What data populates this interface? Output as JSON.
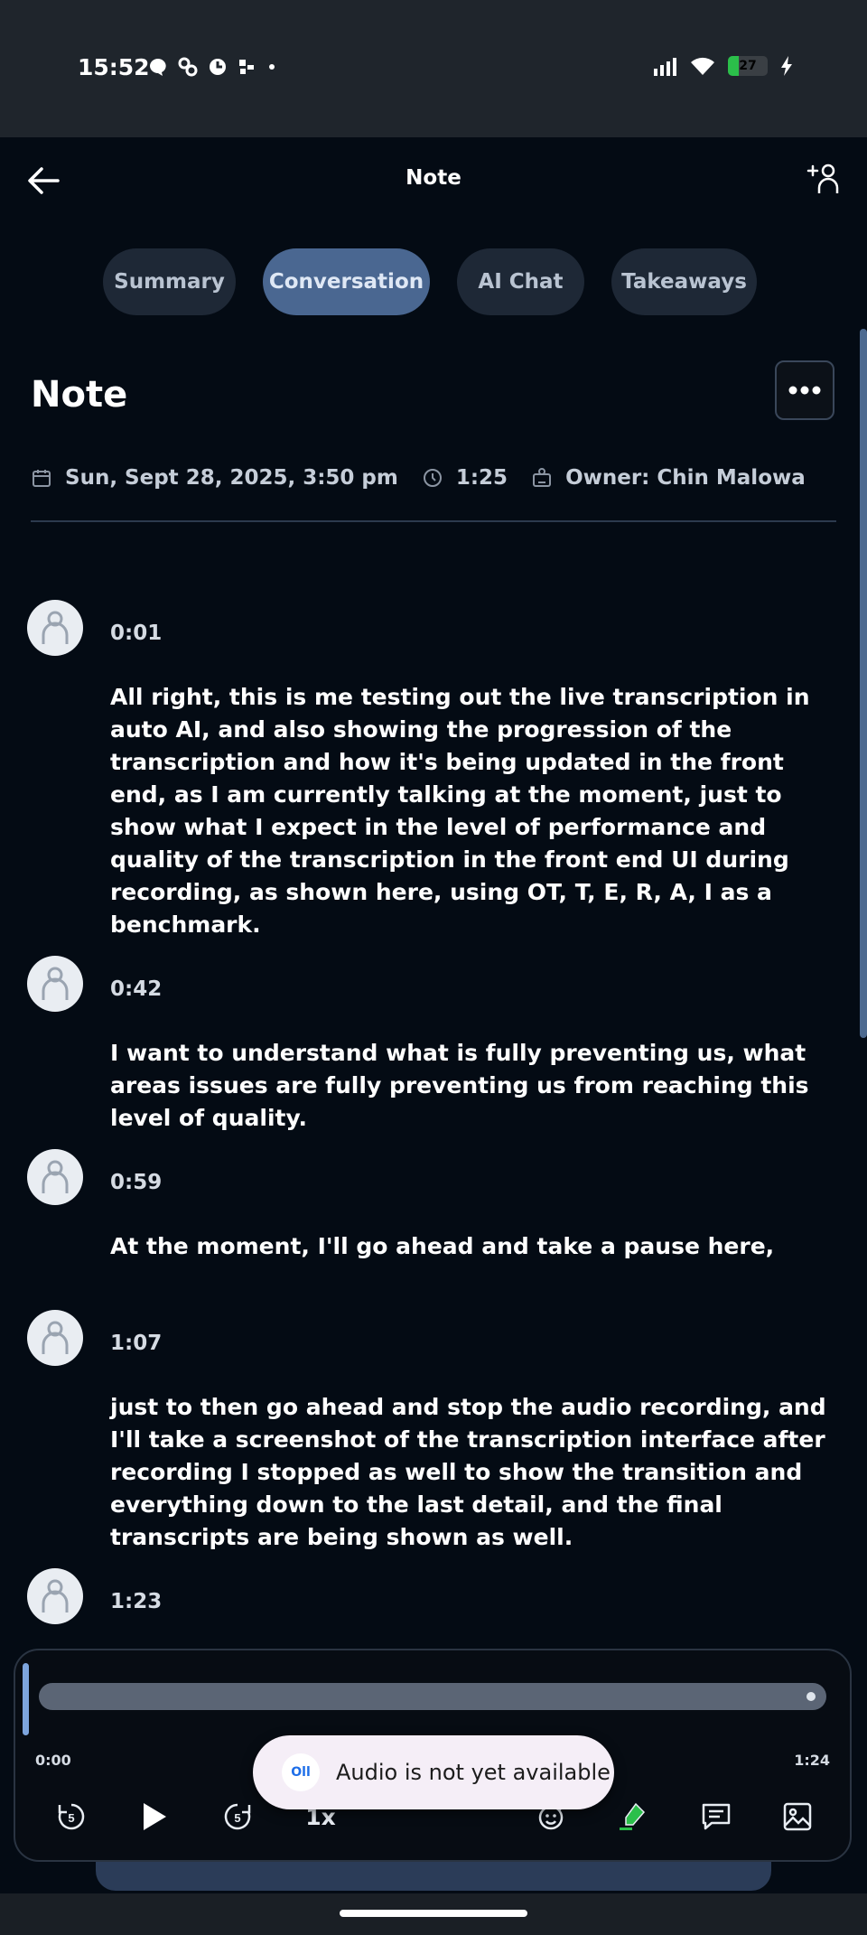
{
  "status_bar": {
    "time": "15:52",
    "battery": "27",
    "battery_level": 0.27
  },
  "header": {
    "title": "Note"
  },
  "tabs": [
    {
      "label": "Summary",
      "active": false
    },
    {
      "label": "Conversation",
      "active": true
    },
    {
      "label": "AI Chat",
      "active": false
    },
    {
      "label": "Takeaways",
      "active": false
    }
  ],
  "note": {
    "title": "Note",
    "date": "Sun, Sept 28, 2025, 3:50 pm",
    "duration": "1:25",
    "owner": "Owner: Chin Malowa"
  },
  "transcript": [
    {
      "time": "0:01",
      "text": "All right, this is me testing out the live transcription in auto AI, and also showing the progression of the transcription and how it's being updated in the front end, as I am currently talking at the moment, just to show what I expect in the level of performance and quality of the transcription in the front end UI during recording, as shown here, using OT, T, E, R, A, I as a benchmark."
    },
    {
      "time": "0:42",
      "text": "I want to understand what is fully preventing us, what areas issues are fully preventing us from reaching this level of quality."
    },
    {
      "time": "0:59",
      "text": "At the moment, I'll go ahead and take a pause here,"
    },
    {
      "time": "1:07",
      "text": "just to then go ahead and stop the audio recording, and I'll take a screenshot of the transcription interface after recording I stopped as well to show the transition and everything down to the last detail, and the final transcripts are being shown as well."
    },
    {
      "time": "1:23",
      "text": ""
    }
  ],
  "player": {
    "current": "0:00",
    "total": "1:24",
    "speed": "1x",
    "progress": 0.0
  },
  "toast": {
    "logo": "Oll",
    "message": "Audio is not yet available"
  },
  "colors": {
    "background": "#040b14",
    "tab_active": "#4a6791",
    "tab_inactive": "#1e2836",
    "accent_green": "#2bbf4a"
  }
}
